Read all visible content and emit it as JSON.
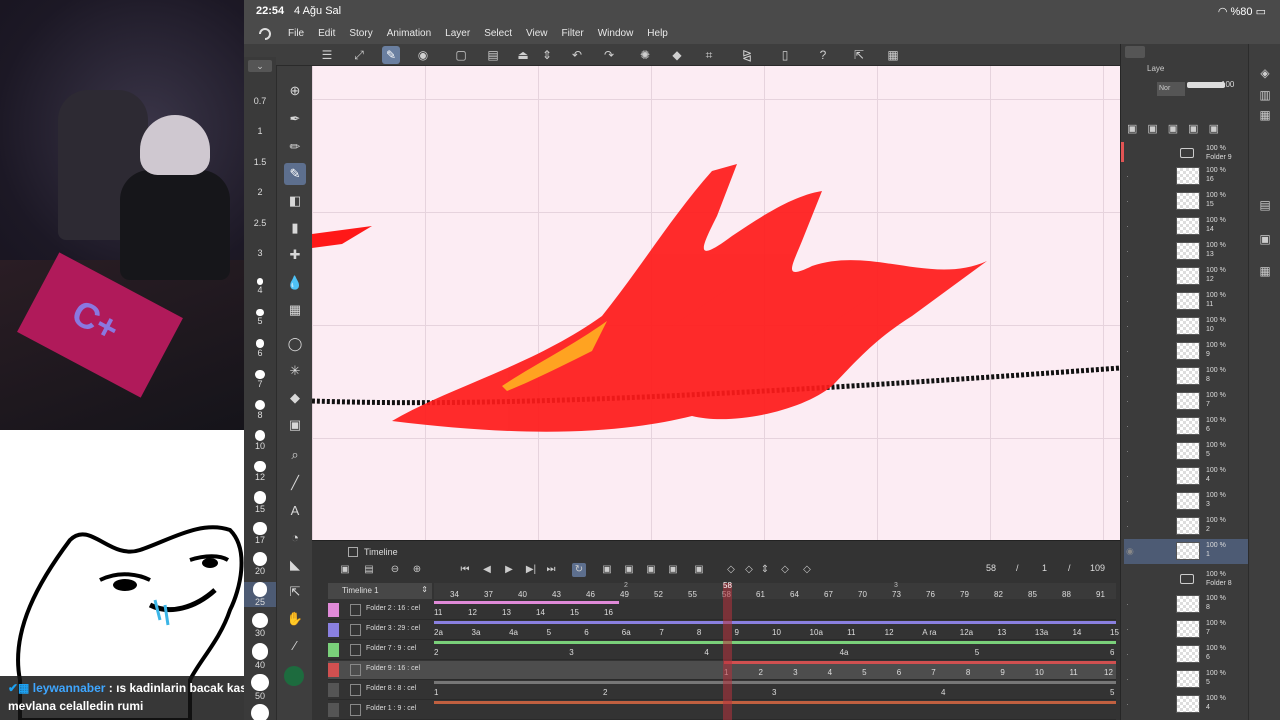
{
  "status_bar": {
    "time": "22:54",
    "date": "4 Ağu Sal",
    "battery": "%80"
  },
  "menu": [
    "File",
    "Edit",
    "Story",
    "Animation",
    "Layer",
    "Select",
    "View",
    "Filter",
    "Window",
    "Help"
  ],
  "brush_sizes": [
    "0.7",
    "1",
    "1.5",
    "2",
    "2.5",
    "3",
    "4",
    "5",
    "6",
    "7",
    "8",
    "10",
    "12",
    "15",
    "17",
    "20",
    "25",
    "30",
    "40",
    "50",
    "60"
  ],
  "chat": {
    "user": "leywannaber",
    "message": ": ıs kadinlarin bacak kaslari daha ustundur",
    "line2": "mevlana celalledin rumi"
  },
  "layer_panel": {
    "tab_label": "Laye",
    "blend_mode": "Nor",
    "opacity": "100",
    "top_folder": {
      "opacity": "100 %",
      "name": "Folder 9"
    },
    "layers": [
      {
        "opacity": "100 %",
        "name": "16"
      },
      {
        "opacity": "100 %",
        "name": "15"
      },
      {
        "opacity": "100 %",
        "name": "14"
      },
      {
        "opacity": "100 %",
        "name": "13"
      },
      {
        "opacity": "100 %",
        "name": "12"
      },
      {
        "opacity": "100 %",
        "name": "11"
      },
      {
        "opacity": "100 %",
        "name": "10"
      },
      {
        "opacity": "100 %",
        "name": "9"
      },
      {
        "opacity": "100 %",
        "name": "8"
      },
      {
        "opacity": "100 %",
        "name": "7"
      },
      {
        "opacity": "100 %",
        "name": "6"
      },
      {
        "opacity": "100 %",
        "name": "5"
      },
      {
        "opacity": "100 %",
        "name": "4"
      },
      {
        "opacity": "100 %",
        "name": "3"
      },
      {
        "opacity": "100 %",
        "name": "2"
      },
      {
        "opacity": "100 %",
        "name": "1"
      }
    ],
    "second_folder": {
      "opacity": "100 %",
      "name": "Folder 8"
    },
    "second_layers": [
      {
        "opacity": "100 %",
        "name": "8"
      },
      {
        "opacity": "100 %",
        "name": "7"
      },
      {
        "opacity": "100 %",
        "name": "6"
      },
      {
        "opacity": "100 %",
        "name": "5"
      },
      {
        "opacity": "100 %",
        "name": "4"
      }
    ]
  },
  "timeline": {
    "title": "Timeline",
    "name": "Timeline 1",
    "current_frame": "58",
    "slash1": "/",
    "frame_field": "1",
    "slash2": "/",
    "total_frames": "109",
    "playhead": "58",
    "ruler": [
      "34",
      "37",
      "40",
      "43",
      "46",
      "49",
      "52",
      "55",
      "58",
      "61",
      "64",
      "67",
      "70",
      "73",
      "76",
      "79",
      "82",
      "85",
      "88",
      "91"
    ],
    "seconds": [
      "2",
      "3"
    ],
    "tracks": [
      {
        "name": "Folder 2 : 16 : cel",
        "color": "#e08ad8",
        "bar_color": "#e08ad8",
        "cels": [
          "11",
          "12",
          "13",
          "14",
          "15",
          "16"
        ]
      },
      {
        "name": "Folder 3 : 29 : cel",
        "color": "#8a80e0",
        "bar_color": "#8a80e0",
        "cels": [
          "2a",
          "3a",
          "4a",
          "5",
          "6",
          "6a",
          "7",
          "8",
          "9",
          "10",
          "10a",
          "11",
          "12",
          "A ra",
          "12a",
          "13",
          "13a",
          "14",
          "15"
        ]
      },
      {
        "name": "Folder 7 : 9 : cel",
        "color": "#7ad07a",
        "bar_color": "#7ad07a",
        "cels": [
          "2",
          "3",
          "4",
          "4a",
          "5",
          "6"
        ]
      },
      {
        "name": "Folder 9 : 16 : cel",
        "color": "#d05050",
        "bar_color": "#d05050",
        "cels": [
          "1",
          "2",
          "3",
          "4",
          "5",
          "6",
          "7",
          "8",
          "9",
          "10",
          "11",
          "12"
        ]
      },
      {
        "name": "Folder 8 : 8 : cel",
        "color": "#555555",
        "bar_color": "#777777",
        "cels": [
          "1",
          "2",
          "3",
          "4",
          "5"
        ]
      },
      {
        "name": "Folder 1 : 9 : cel",
        "color": "#555555",
        "bar_color": "#c06040",
        "cels": []
      }
    ]
  }
}
